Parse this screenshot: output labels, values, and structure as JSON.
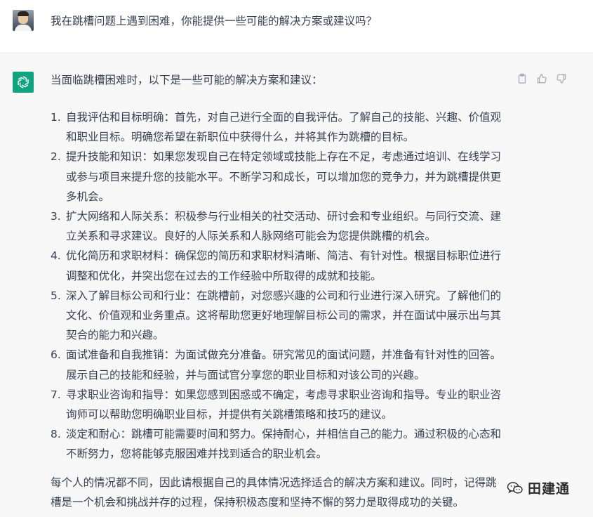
{
  "user_message": {
    "text": "我在跳槽问题上遇到困难，你能提供一些可能的解决方案或建议吗？"
  },
  "assistant_message": {
    "intro": "当面临跳槽困难时，以下是一些可能的解决方案和建议：",
    "items": [
      {
        "num": "1.",
        "text": "自我评估和目标明确：首先，对自己进行全面的自我评估。了解自己的技能、兴趣、价值观和职业目标。明确您希望在新职位中获得什么，并将其作为跳槽的目标。"
      },
      {
        "num": "2.",
        "text": "提升技能和知识：如果您发现自己在特定领域或技能上存在不足，考虑通过培训、在线学习或参与项目来提升您的技能水平。不断学习和成长，可以增加您的竞争力，并为跳槽提供更多机会。"
      },
      {
        "num": "3.",
        "text": "扩大网络和人际关系：积极参与行业相关的社交活动、研讨会和专业组织。与同行交流、建立关系和寻求建议。良好的人际关系和人脉网络可能会为您提供跳槽的机会。"
      },
      {
        "num": "4.",
        "text": "优化简历和求职材料：确保您的简历和求职材料清晰、简洁、有针对性。根据目标职位进行调整和优化，并突出您在过去的工作经验中所取得的成就和技能。"
      },
      {
        "num": "5.",
        "text": "深入了解目标公司和行业：在跳槽前，对您感兴趣的公司和行业进行深入研究。了解他们的文化、价值观和业务重点。这将帮助您更好地理解目标公司的需求，并在面试中展示出与其契合的能力和兴趣。"
      },
      {
        "num": "6.",
        "text": "面试准备和自我推销：为面试做充分准备。研究常见的面试问题，并准备有针对性的回答。展示自己的技能和经验，并与面试官分享您的职业目标和对该公司的兴趣。"
      },
      {
        "num": "7.",
        "text": "寻求职业咨询和指导：如果您感到困惑或不确定，考虑寻求职业咨询和指导。专业的职业咨询师可以帮助您明确职业目标，并提供有关跳槽策略和技巧的建议。"
      },
      {
        "num": "8.",
        "text": "淡定和耐心：跳槽可能需要时间和努力。保持耐心，并相信自己的能力。通过积极的心态和不断努力，您将能够克服困难并找到适合的职业机会。"
      }
    ],
    "outro": "每个人的情况都不同，因此请根据自己的具体情况选择适合的解决方案和建议。同时，记得跳槽是一个机会和挑战并存的过程，保持积极态度和坚持不懈的努力是取得成功的关键。",
    "actions": [
      {
        "icon": "clipboard-icon"
      },
      {
        "icon": "thumbs-up-icon"
      },
      {
        "icon": "thumbs-down-icon"
      }
    ]
  },
  "watermark": {
    "text": "田建通",
    "icon": "wechat-icon"
  },
  "colors": {
    "accent": "#10a37f",
    "text": "#374151",
    "assistant_bg": "#f7f7f8",
    "icon": "#acacbe"
  }
}
